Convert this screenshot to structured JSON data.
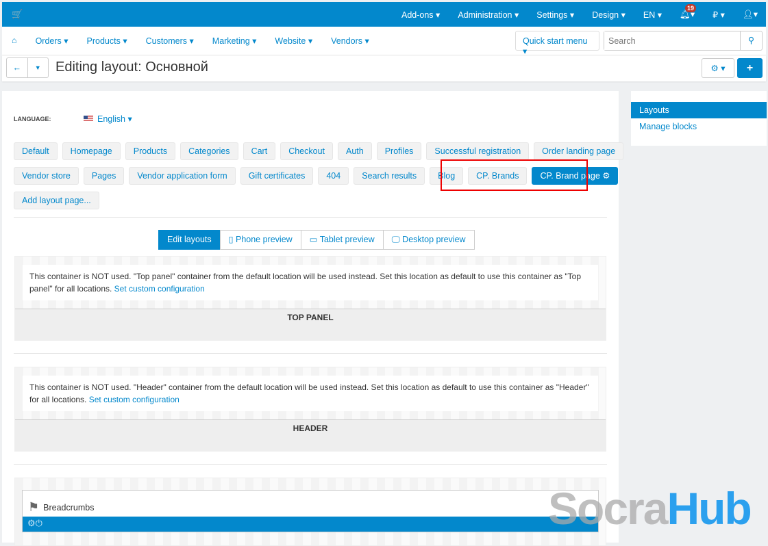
{
  "topbar": {
    "items": [
      "Add-ons ▾",
      "Administration ▾",
      "Settings ▾",
      "Design ▾",
      "EN ▾"
    ],
    "notifications": "19",
    "currency": "₽ ▾"
  },
  "nav": {
    "items": [
      "Orders ▾",
      "Products ▾",
      "Customers ▾",
      "Marketing ▾",
      "Website ▾",
      "Vendors ▾"
    ],
    "quick_start": "Quick start menu ▾",
    "search_placeholder": "Search"
  },
  "title": "Editing layout: Основной",
  "language": {
    "label": "LANGUAGE:",
    "value": "English ▾"
  },
  "layout_tabs": [
    [
      "Default",
      "Homepage",
      "Products",
      "Categories",
      "Cart",
      "Checkout",
      "Auth",
      "Profiles",
      "Successful registration",
      "Order landing page"
    ],
    [
      "Vendor store",
      "Pages",
      "Vendor application form",
      "Gift certificates",
      "404",
      "Search results",
      "Blog",
      "CP. Brands",
      "CP. Brand page ⚙"
    ],
    [
      "Add layout page..."
    ]
  ],
  "active_tab": "CP. Brand page ⚙",
  "previews": [
    "Edit layouts",
    "▯ Phone preview",
    "▭ Tablet preview",
    "🖵 Desktop preview"
  ],
  "containers": [
    {
      "notice": "This container is NOT used. \"Top panel\" container from the default location will be used instead. Set this location as default to use this container as \"Top panel\" for all locations.",
      "link": "Set custom configuration",
      "name": "TOP PANEL"
    },
    {
      "notice": "This container is NOT used. \"Header\" container from the default location will be used instead. Set this location as default to use this container as \"Header\" for all locations.",
      "link": "Set custom configuration",
      "name": "HEADER"
    }
  ],
  "block": {
    "name": "Breadcrumbs"
  },
  "sidebar": {
    "active": "Layouts",
    "link": "Manage blocks"
  },
  "watermark": {
    "a": "Socra",
    "b": "Hub"
  }
}
